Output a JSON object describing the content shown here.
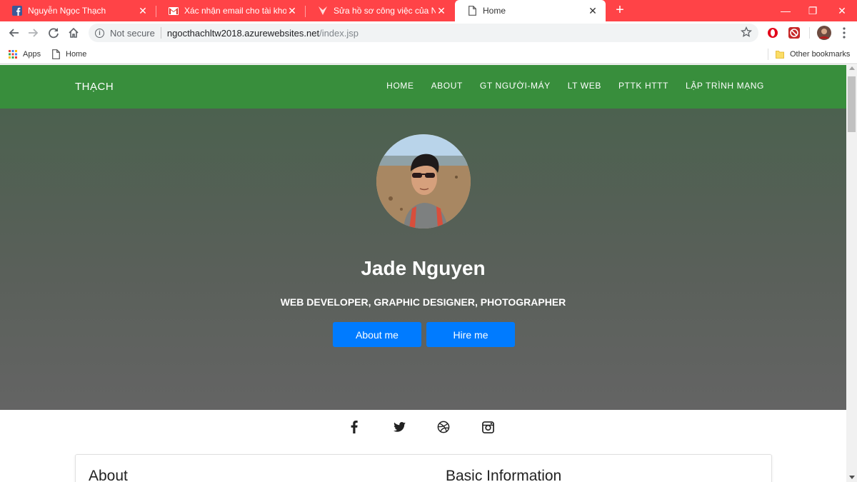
{
  "browser": {
    "tabs": [
      {
        "title": "Nguyễn Ngọc Thạch",
        "icon": "facebook-icon"
      },
      {
        "title": "Xác nhận email cho tài khoản vLance",
        "icon": "gmail-icon"
      },
      {
        "title": "Sửa hồ sơ công việc của Nguyễn",
        "icon": "vlance-icon"
      },
      {
        "title": "Home",
        "icon": "page-icon"
      }
    ],
    "url_security": "Not secure",
    "url_host": "ngocthachltw2018.azurewebsites.net",
    "url_path": "/index.jsp",
    "bookmarks": [
      {
        "label": "Apps"
      },
      {
        "label": "Home"
      }
    ],
    "other_bookmarks": "Other bookmarks",
    "tabstrip_color": "#ff4347"
  },
  "site": {
    "brand": "THẠCH",
    "menu": [
      "HOME",
      "ABOUT",
      "GT NGƯỜI-MÁY",
      "LT WEB",
      "PTTK HTTT",
      "LẬP TRÌNH MẠNG"
    ],
    "nav_color": "#388e3c",
    "hero": {
      "name": "Jade Nguyen",
      "tagline": "WEB DEVELOPER, GRAPHIC DESIGNER, PHOTOGRAPHER",
      "buttons": [
        "About me",
        "Hire me"
      ],
      "button_color": "#007bff"
    },
    "social": [
      "facebook-icon",
      "twitter-icon",
      "dribbble-icon",
      "instagram-icon"
    ],
    "sections": {
      "about_title": "About",
      "basic_title": "Basic Information"
    }
  }
}
